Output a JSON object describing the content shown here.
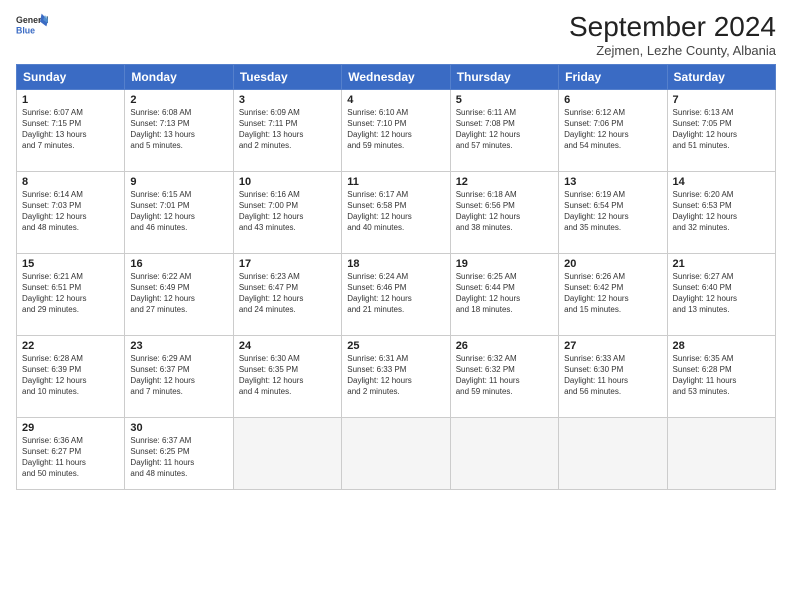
{
  "header": {
    "logo_line1": "General",
    "logo_line2": "Blue",
    "month_title": "September 2024",
    "subtitle": "Zejmen, Lezhe County, Albania"
  },
  "weekdays": [
    "Sunday",
    "Monday",
    "Tuesday",
    "Wednesday",
    "Thursday",
    "Friday",
    "Saturday"
  ],
  "weeks": [
    [
      {
        "day": "1",
        "info": "Sunrise: 6:07 AM\nSunset: 7:15 PM\nDaylight: 13 hours\nand 7 minutes."
      },
      {
        "day": "2",
        "info": "Sunrise: 6:08 AM\nSunset: 7:13 PM\nDaylight: 13 hours\nand 5 minutes."
      },
      {
        "day": "3",
        "info": "Sunrise: 6:09 AM\nSunset: 7:11 PM\nDaylight: 13 hours\nand 2 minutes."
      },
      {
        "day": "4",
        "info": "Sunrise: 6:10 AM\nSunset: 7:10 PM\nDaylight: 12 hours\nand 59 minutes."
      },
      {
        "day": "5",
        "info": "Sunrise: 6:11 AM\nSunset: 7:08 PM\nDaylight: 12 hours\nand 57 minutes."
      },
      {
        "day": "6",
        "info": "Sunrise: 6:12 AM\nSunset: 7:06 PM\nDaylight: 12 hours\nand 54 minutes."
      },
      {
        "day": "7",
        "info": "Sunrise: 6:13 AM\nSunset: 7:05 PM\nDaylight: 12 hours\nand 51 minutes."
      }
    ],
    [
      {
        "day": "8",
        "info": "Sunrise: 6:14 AM\nSunset: 7:03 PM\nDaylight: 12 hours\nand 48 minutes."
      },
      {
        "day": "9",
        "info": "Sunrise: 6:15 AM\nSunset: 7:01 PM\nDaylight: 12 hours\nand 46 minutes."
      },
      {
        "day": "10",
        "info": "Sunrise: 6:16 AM\nSunset: 7:00 PM\nDaylight: 12 hours\nand 43 minutes."
      },
      {
        "day": "11",
        "info": "Sunrise: 6:17 AM\nSunset: 6:58 PM\nDaylight: 12 hours\nand 40 minutes."
      },
      {
        "day": "12",
        "info": "Sunrise: 6:18 AM\nSunset: 6:56 PM\nDaylight: 12 hours\nand 38 minutes."
      },
      {
        "day": "13",
        "info": "Sunrise: 6:19 AM\nSunset: 6:54 PM\nDaylight: 12 hours\nand 35 minutes."
      },
      {
        "day": "14",
        "info": "Sunrise: 6:20 AM\nSunset: 6:53 PM\nDaylight: 12 hours\nand 32 minutes."
      }
    ],
    [
      {
        "day": "15",
        "info": "Sunrise: 6:21 AM\nSunset: 6:51 PM\nDaylight: 12 hours\nand 29 minutes."
      },
      {
        "day": "16",
        "info": "Sunrise: 6:22 AM\nSunset: 6:49 PM\nDaylight: 12 hours\nand 27 minutes."
      },
      {
        "day": "17",
        "info": "Sunrise: 6:23 AM\nSunset: 6:47 PM\nDaylight: 12 hours\nand 24 minutes."
      },
      {
        "day": "18",
        "info": "Sunrise: 6:24 AM\nSunset: 6:46 PM\nDaylight: 12 hours\nand 21 minutes."
      },
      {
        "day": "19",
        "info": "Sunrise: 6:25 AM\nSunset: 6:44 PM\nDaylight: 12 hours\nand 18 minutes."
      },
      {
        "day": "20",
        "info": "Sunrise: 6:26 AM\nSunset: 6:42 PM\nDaylight: 12 hours\nand 15 minutes."
      },
      {
        "day": "21",
        "info": "Sunrise: 6:27 AM\nSunset: 6:40 PM\nDaylight: 12 hours\nand 13 minutes."
      }
    ],
    [
      {
        "day": "22",
        "info": "Sunrise: 6:28 AM\nSunset: 6:39 PM\nDaylight: 12 hours\nand 10 minutes."
      },
      {
        "day": "23",
        "info": "Sunrise: 6:29 AM\nSunset: 6:37 PM\nDaylight: 12 hours\nand 7 minutes."
      },
      {
        "day": "24",
        "info": "Sunrise: 6:30 AM\nSunset: 6:35 PM\nDaylight: 12 hours\nand 4 minutes."
      },
      {
        "day": "25",
        "info": "Sunrise: 6:31 AM\nSunset: 6:33 PM\nDaylight: 12 hours\nand 2 minutes."
      },
      {
        "day": "26",
        "info": "Sunrise: 6:32 AM\nSunset: 6:32 PM\nDaylight: 11 hours\nand 59 minutes."
      },
      {
        "day": "27",
        "info": "Sunrise: 6:33 AM\nSunset: 6:30 PM\nDaylight: 11 hours\nand 56 minutes."
      },
      {
        "day": "28",
        "info": "Sunrise: 6:35 AM\nSunset: 6:28 PM\nDaylight: 11 hours\nand 53 minutes."
      }
    ],
    [
      {
        "day": "29",
        "info": "Sunrise: 6:36 AM\nSunset: 6:27 PM\nDaylight: 11 hours\nand 50 minutes."
      },
      {
        "day": "30",
        "info": "Sunrise: 6:37 AM\nSunset: 6:25 PM\nDaylight: 11 hours\nand 48 minutes."
      },
      {
        "day": "",
        "info": ""
      },
      {
        "day": "",
        "info": ""
      },
      {
        "day": "",
        "info": ""
      },
      {
        "day": "",
        "info": ""
      },
      {
        "day": "",
        "info": ""
      }
    ]
  ]
}
